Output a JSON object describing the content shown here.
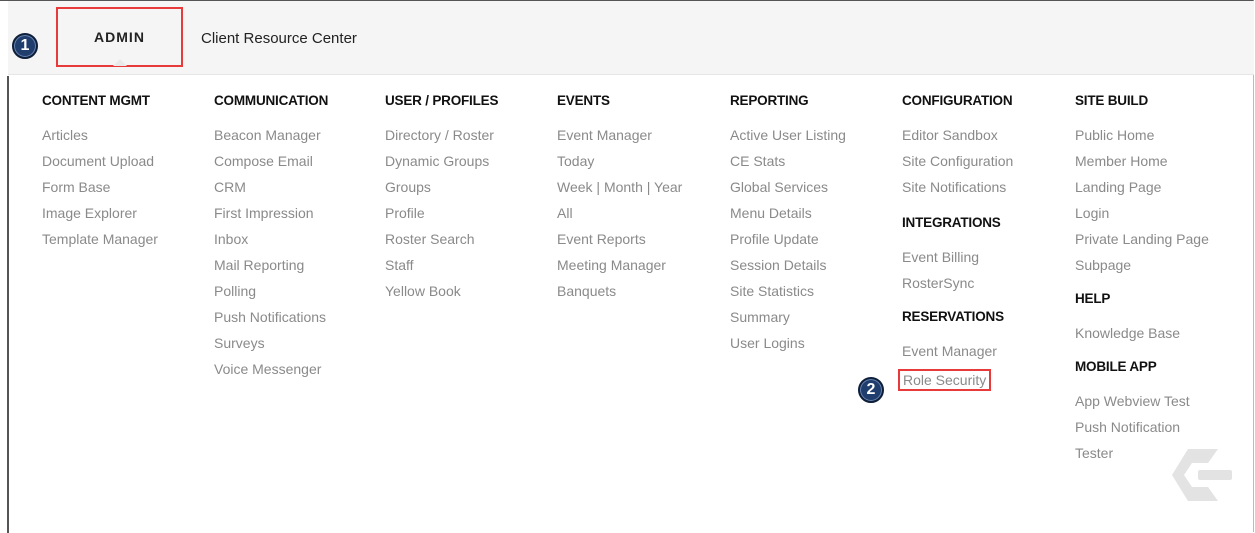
{
  "nav": {
    "admin_label": "ADMIN",
    "crc_label": "Client Resource Center"
  },
  "badges": {
    "one": "1",
    "two": "2"
  },
  "menu": {
    "content_mgmt": {
      "heading": "CONTENT MGMT",
      "items": [
        "Articles",
        "Document Upload",
        "Form Base",
        "Image Explorer",
        "Template Manager"
      ]
    },
    "communication": {
      "heading": "COMMUNICATION",
      "items": [
        "Beacon Manager",
        "Compose Email",
        "CRM",
        "First Impression",
        "Inbox",
        "Mail Reporting",
        "Polling",
        "Push Notifications",
        "Surveys",
        "Voice Messenger"
      ]
    },
    "user_profiles": {
      "heading": "USER / PROFILES",
      "items": [
        "Directory / Roster",
        "Dynamic Groups",
        "Groups",
        "Profile",
        "Roster Search",
        "Staff",
        "Yellow Book"
      ]
    },
    "events": {
      "heading": "EVENTS",
      "items": [
        "Event Manager",
        "Today",
        "Week | Month | Year",
        "All",
        "Event Reports",
        "Meeting Manager",
        "Banquets"
      ]
    },
    "reporting": {
      "heading": "REPORTING",
      "items": [
        "Active User Listing",
        "CE Stats",
        "Global Services",
        "Menu Details",
        "Profile Update",
        "Session Details",
        "Site Statistics",
        "Summary",
        "User Logins"
      ]
    },
    "configuration": {
      "heading": "CONFIGURATION",
      "items": [
        "Editor Sandbox",
        "Site Configuration",
        "Site Notifications"
      ]
    },
    "integrations": {
      "heading": "INTEGRATIONS",
      "items": [
        "Event Billing",
        "RosterSync"
      ]
    },
    "reservations": {
      "heading": "RESERVATIONS",
      "items": [
        "Event Manager",
        "Role Security"
      ]
    },
    "site_build": {
      "heading": "SITE BUILD",
      "items": [
        "Public Home",
        "Member Home",
        "Landing Page",
        "Login",
        "Private Landing Page",
        "Subpage"
      ]
    },
    "help": {
      "heading": "HELP",
      "items": [
        "Knowledge Base"
      ]
    },
    "mobile_app": {
      "heading": "MOBILE APP",
      "items": [
        "App Webview Test",
        "Push Notification",
        "Tester"
      ]
    }
  },
  "colors": {
    "highlight": "#e8393b",
    "badge": "#1f3d6d",
    "link_gray": "#8a8a8a"
  },
  "icons": {
    "logo": "brand-logo-icon"
  }
}
